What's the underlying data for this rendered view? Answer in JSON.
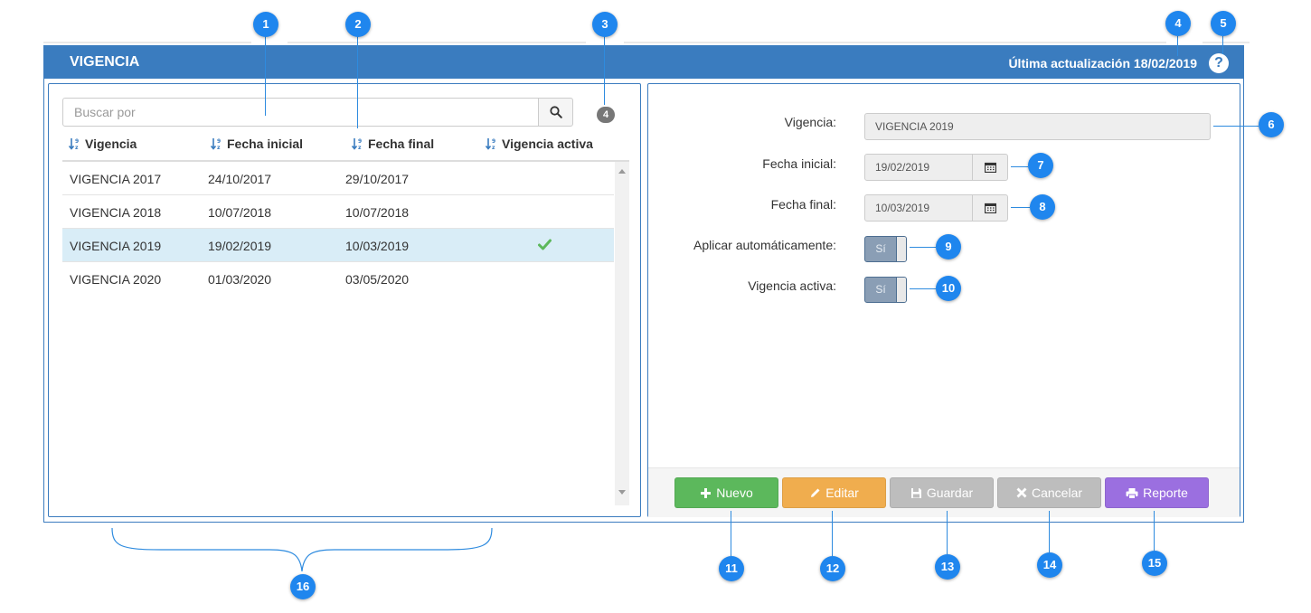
{
  "header": {
    "title": "VIGENCIA",
    "last_update": "Última actualización 18/02/2019",
    "help_icon": "question-circle-icon"
  },
  "search": {
    "placeholder": "Buscar por",
    "button_icon": "search-icon",
    "count": "4"
  },
  "grid": {
    "columns": [
      "Vigencia",
      "Fecha inicial",
      "Fecha final",
      "Vigencia activa"
    ],
    "rows": [
      {
        "vigencia": "VIGENCIA 2017",
        "fecha_inicial": "24/10/2017",
        "fecha_final": "29/10/2017",
        "activa": false
      },
      {
        "vigencia": "VIGENCIA 2018",
        "fecha_inicial": "10/07/2018",
        "fecha_final": "10/07/2018",
        "activa": false
      },
      {
        "vigencia": "VIGENCIA 2019",
        "fecha_inicial": "19/02/2019",
        "fecha_final": "10/03/2019",
        "activa": true
      },
      {
        "vigencia": "VIGENCIA 2020",
        "fecha_inicial": "01/03/2020",
        "fecha_final": "03/05/2020",
        "activa": false
      }
    ],
    "selected_row": 2
  },
  "form": {
    "vigencia_label": "Vigencia:",
    "vigencia_value": "VIGENCIA 2019",
    "fecha_inicial_label": "Fecha inicial:",
    "fecha_inicial_value": "19/02/2019",
    "fecha_final_label": "Fecha final:",
    "fecha_final_value": "10/03/2019",
    "aplicar_label": "Aplicar automáticamente:",
    "aplicar_value": "Sí",
    "activa_label": "Vigencia activa:",
    "activa_value": "Sí"
  },
  "buttons": {
    "nuevo": "Nuevo",
    "editar": "Editar",
    "guardar": "Guardar",
    "cancelar": "Cancelar",
    "reporte": "Reporte"
  },
  "colors": {
    "header_blue": "#3a7cbf",
    "nuevo": "#5cb85c",
    "editar": "#f0ad4e",
    "disabled": "#bdbdbd",
    "reporte": "#9b6fe0",
    "callout": "#1f86ee"
  },
  "callouts": [
    "1",
    "2",
    "3",
    "4",
    "5",
    "6",
    "7",
    "8",
    "9",
    "10",
    "11",
    "12",
    "13",
    "14",
    "15",
    "16"
  ]
}
